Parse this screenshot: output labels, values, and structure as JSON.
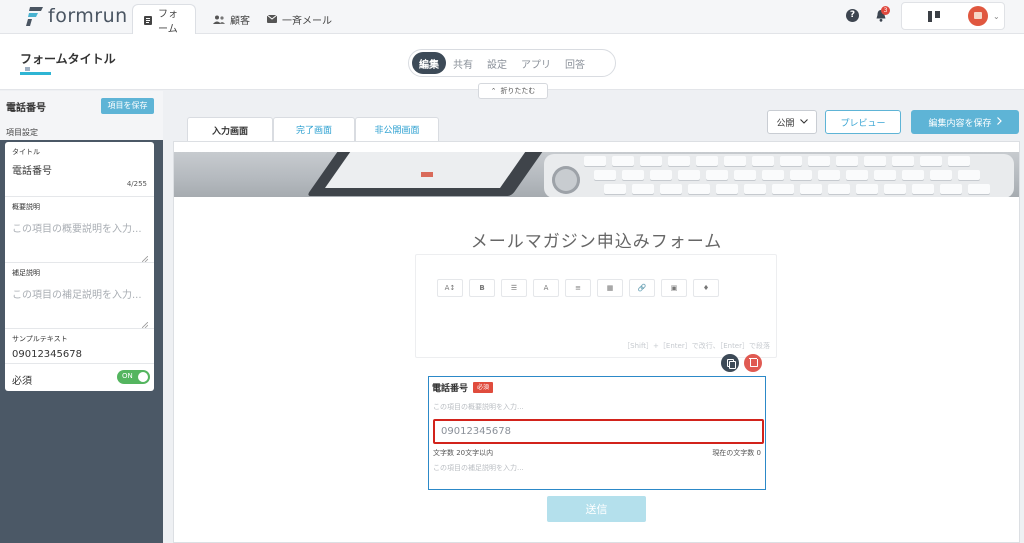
{
  "app": {
    "logo_text": "formrun"
  },
  "topnav": {
    "tabs": [
      {
        "label": "フォーム",
        "icon": "form-icon"
      },
      {
        "label": "顧客",
        "icon": "customers-icon"
      },
      {
        "label": "一斉メール",
        "icon": "mail-icon"
      }
    ],
    "notification_count": "3",
    "help_glyph": "?"
  },
  "header": {
    "form_title": "フォームタイトル",
    "segments": [
      "編集",
      "共有",
      "設定",
      "アプリ",
      "回答"
    ],
    "fold_label": "折りたたむ"
  },
  "sidebar": {
    "title": "電話番号",
    "save_label": "項目を保存",
    "section_label": "項目設定",
    "fields": {
      "title_label": "タイトル",
      "title_value": "電話番号",
      "title_count": "4/255",
      "desc_label": "概要説明",
      "desc_placeholder": "この項目の概要説明を入力...",
      "note_label": "補足説明",
      "note_placeholder": "この項目の補足説明を入力...",
      "sample_label": "サンプルテキスト",
      "sample_value": "09012345678",
      "required_label": "必須",
      "toggle_label": "ON"
    }
  },
  "main": {
    "form_tabs": [
      "入力画面",
      "完了画面",
      "非公開画面"
    ],
    "publish_label": "公開",
    "preview_label": "プレビュー",
    "save_label": "編集内容を保存",
    "form_heading": "メールマガジン申込みフォーム",
    "toolbar": [
      "A↕",
      "B",
      "☰",
      "A",
      "≡",
      "▦",
      "🔗",
      "▣",
      "♦"
    ],
    "editor_hint": "［Shift］+［Enter］で改行、［Enter］で段落",
    "field": {
      "label": "電話番号",
      "required_badge": "必須",
      "desc_placeholder": "この項目の概要説明を入力...",
      "input_placeholder": "09012345678",
      "limit_text": "文字数 20文字以内",
      "count_text": "現在の文字数 0",
      "note_placeholder": "この項目の補足説明を入力..."
    },
    "submit_label": "送信"
  },
  "colors": {
    "accent": "#5eb4d6",
    "dark": "#3d4a57",
    "danger": "#d2231b",
    "success": "#54b55f"
  }
}
